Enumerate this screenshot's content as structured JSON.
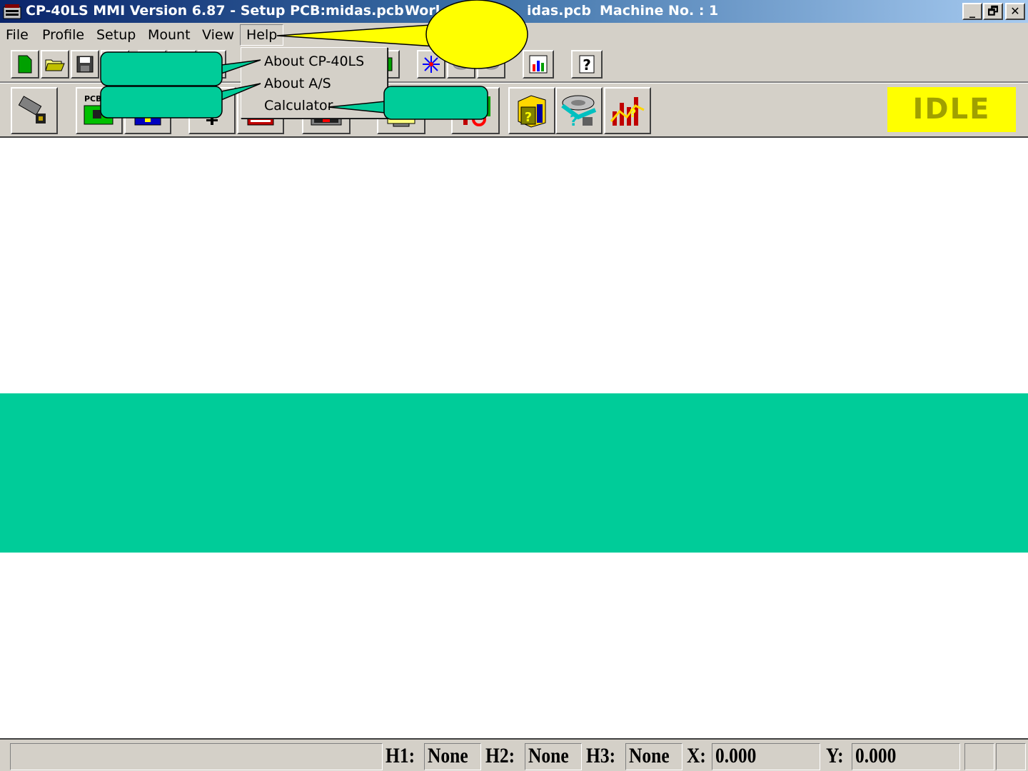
{
  "titlebar": {
    "part1": "CP-40LS MMI Version 6.87 - Setup PCB:midas.pcb",
    "part2": "Worl",
    "part3": "idas.pcb",
    "part4": "Machine No. : 1",
    "minimize": "_",
    "restore": "🗗",
    "close": "✕"
  },
  "menubar": {
    "items": [
      "File",
      "Profile",
      "Setup",
      "Mount",
      "View",
      "Help"
    ]
  },
  "help_menu": {
    "items": [
      "About CP-40LS",
      "About A/S",
      "Calculator"
    ]
  },
  "status_indicator": "IDLE",
  "statusbar": {
    "h1_label": "H1:",
    "h1_value": "None",
    "h2_label": "H2:",
    "h2_value": "None",
    "h3_label": "H3:",
    "h3_value": "None",
    "x_label": "X:",
    "x_value": "0.000",
    "y_label": "Y:",
    "y_value": "0.000"
  },
  "colors": {
    "callout_yellow": "#ffff00",
    "callout_teal": "#00cc99",
    "band": "#00cc99",
    "idle_bg": "#ffff00"
  }
}
